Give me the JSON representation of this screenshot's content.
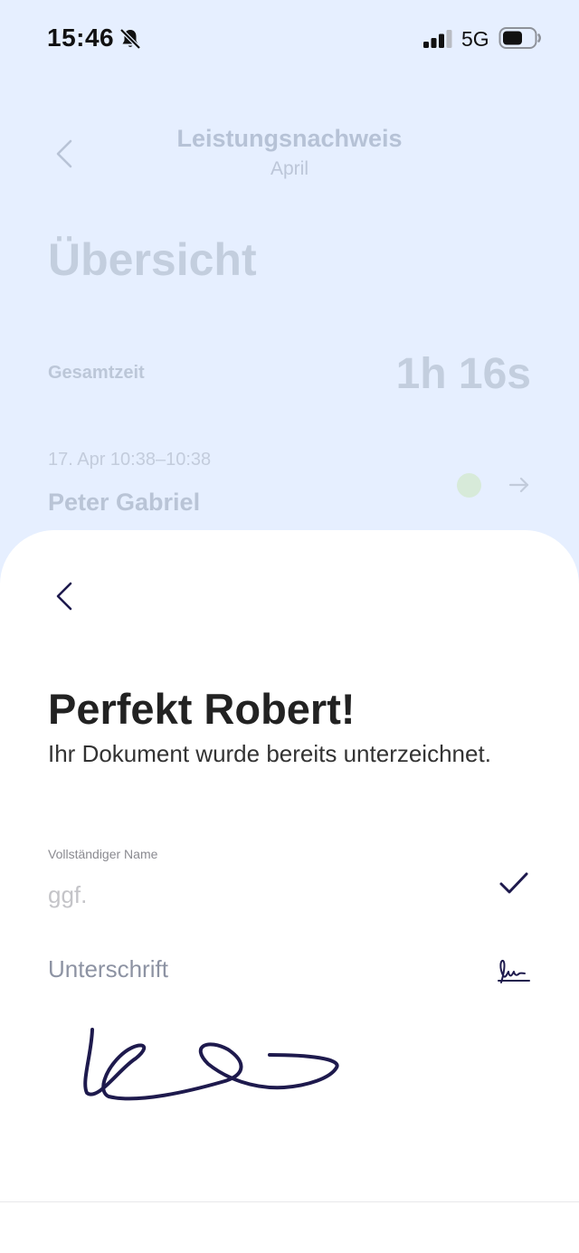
{
  "status_bar": {
    "time": "15:46",
    "network": "5G"
  },
  "background": {
    "title": "Leistungsnachweis",
    "subtitle": "April",
    "heading": "Übersicht",
    "total_label": "Gesamtzeit",
    "total_value": "1h 16s",
    "entry": {
      "date": "17. Apr 10:38–10:38",
      "name": "Peter Gabriel"
    }
  },
  "sheet": {
    "title": "Perfekt Robert!",
    "subtitle": "Ihr Dokument wurde bereits unterzeichnet.",
    "name_field": {
      "label": "Vollständiger Name",
      "placeholder": "ggf.",
      "value": ""
    },
    "signature": {
      "label": "Unterschrift"
    }
  },
  "colors": {
    "background": "#e6efff",
    "ink": "#1e1a4d",
    "sheet": "#ffffff"
  },
  "icons": {
    "bell": "bell-slash-icon",
    "signal": "cellular-signal-icon",
    "battery": "battery-icon",
    "back": "chevron-left-icon",
    "check": "checkmark-icon",
    "arrow": "arrow-right-icon",
    "signature": "signature-icon"
  }
}
